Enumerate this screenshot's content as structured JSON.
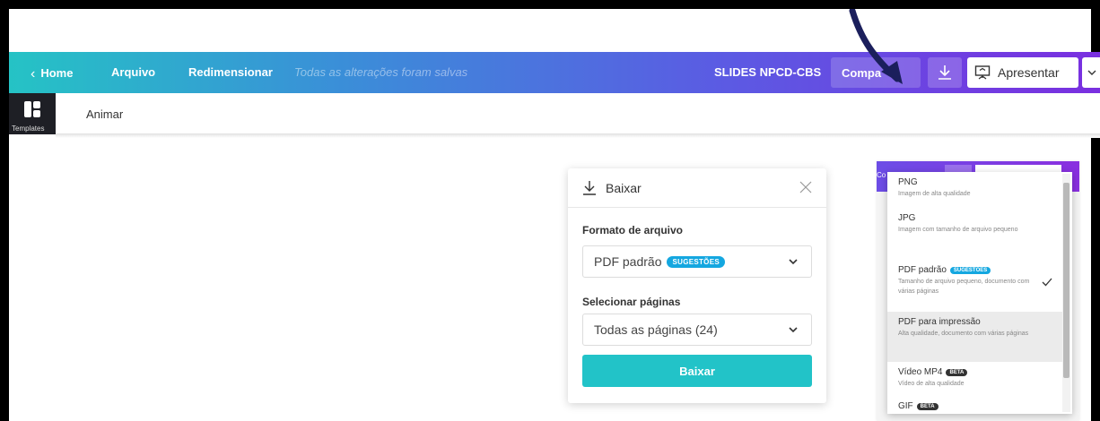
{
  "topbar": {
    "home_label": "Home",
    "arquivo_label": "Arquivo",
    "redimensionar_label": "Redimensionar",
    "saved_status": "Todas as alterações foram salvas",
    "doc_title": "SLIDES NPCD-CBS",
    "share_label": "Compa",
    "present_label": "Apresentar"
  },
  "subbar": {
    "templates_label": "Templates",
    "animar_label": "Animar"
  },
  "download_panel": {
    "title": "Baixar",
    "format_label": "Formato de arquivo",
    "format_value": "PDF padrão",
    "format_badge": "SUGESTÕES",
    "pages_label": "Selecionar páginas",
    "pages_value": "Todas as páginas (24)",
    "button_label": "Baixar"
  },
  "mini": {
    "corner_text": "Co",
    "formats": [
      {
        "name": "PNG",
        "desc": "Imagem de alta qualidade"
      },
      {
        "name": "JPG",
        "desc": "Imagem com tamanho de arquivo pequeno"
      },
      {
        "name": "PDF padrão",
        "badge": "SUGESTÕES",
        "desc": "Tamanho de arquivo pequeno, documento com várias páginas"
      },
      {
        "name": "PDF para impressão",
        "desc": "Alta qualidade, documento com várias páginas"
      },
      {
        "name": "Vídeo MP4",
        "badge": "BETA",
        "desc": "Vídeo de alta qualidade"
      },
      {
        "name": "GIF",
        "badge": "BETA"
      }
    ]
  },
  "colors": {
    "accent_teal": "#22c3c8",
    "badge_blue": "#14a7e0",
    "arrow_navy": "#1b1f5c"
  }
}
